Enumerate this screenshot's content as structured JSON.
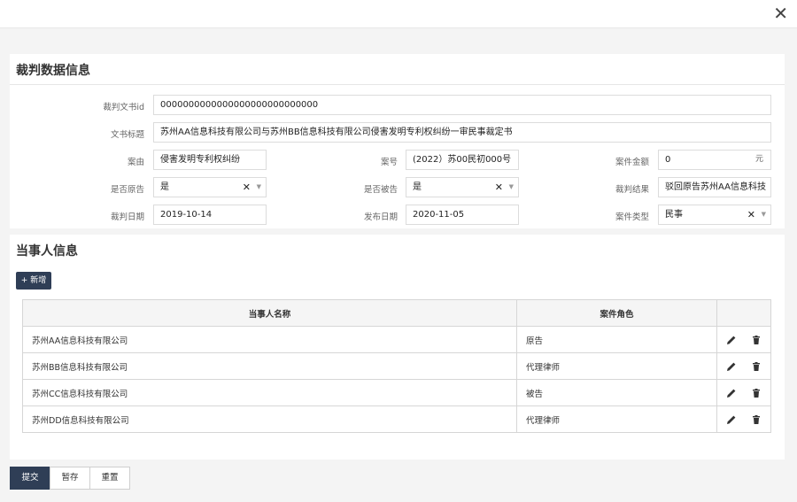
{
  "dialog": {
    "close_glyph": "✕"
  },
  "judgment": {
    "title": "裁判数据信息",
    "doc_id_label": "裁判文书id",
    "doc_id_value": "0000000000000000000000000000",
    "doc_title_label": "文书标题",
    "doc_title_value": "苏州AA信息科技有限公司与苏州BB信息科技有限公司侵害发明专利权纠纷一审民事裁定书",
    "cause_label": "案由",
    "cause_value": "侵害发明专利权纠纷",
    "case_no_label": "案号",
    "case_no_value": "(2022）苏00民初000号",
    "amount_label": "案件金额",
    "amount_value": "0",
    "amount_unit": "元",
    "is_plaintiff_label": "是否原告",
    "is_plaintiff_value": "是",
    "is_defendant_label": "是否被告",
    "is_defendant_value": "是",
    "result_label": "裁判结果",
    "result_value": "驳回原告苏州AA信息科技",
    "date_label": "裁判日期",
    "date_value": "2019-10-14",
    "publish_date_label": "发布日期",
    "publish_date_value": "2020-11-05",
    "case_type_label": "案件类型",
    "case_type_value": "民事",
    "clear_glyph": "✕",
    "caret_glyph": "▼"
  },
  "parties": {
    "title": "当事人信息",
    "add_label": "+ 新增",
    "columns": [
      "当事人名称",
      "案件角色",
      ""
    ],
    "rows": [
      {
        "name": "苏州AA信息科技有限公司",
        "role": "原告"
      },
      {
        "name": "苏州BB信息科技有限公司",
        "role": "代理律师"
      },
      {
        "name": "苏州CC信息科技有限公司",
        "role": "被告"
      },
      {
        "name": "苏州DD信息科技有限公司",
        "role": "代理律师"
      }
    ],
    "icons": {
      "edit": "pencil-icon",
      "delete": "trash-icon"
    }
  },
  "footer": {
    "submit_label": "提交",
    "draft_label": "暂存",
    "reset_label": "重置"
  },
  "colors": {
    "primary": "#2f3e56",
    "background": "#f4f4f4"
  }
}
